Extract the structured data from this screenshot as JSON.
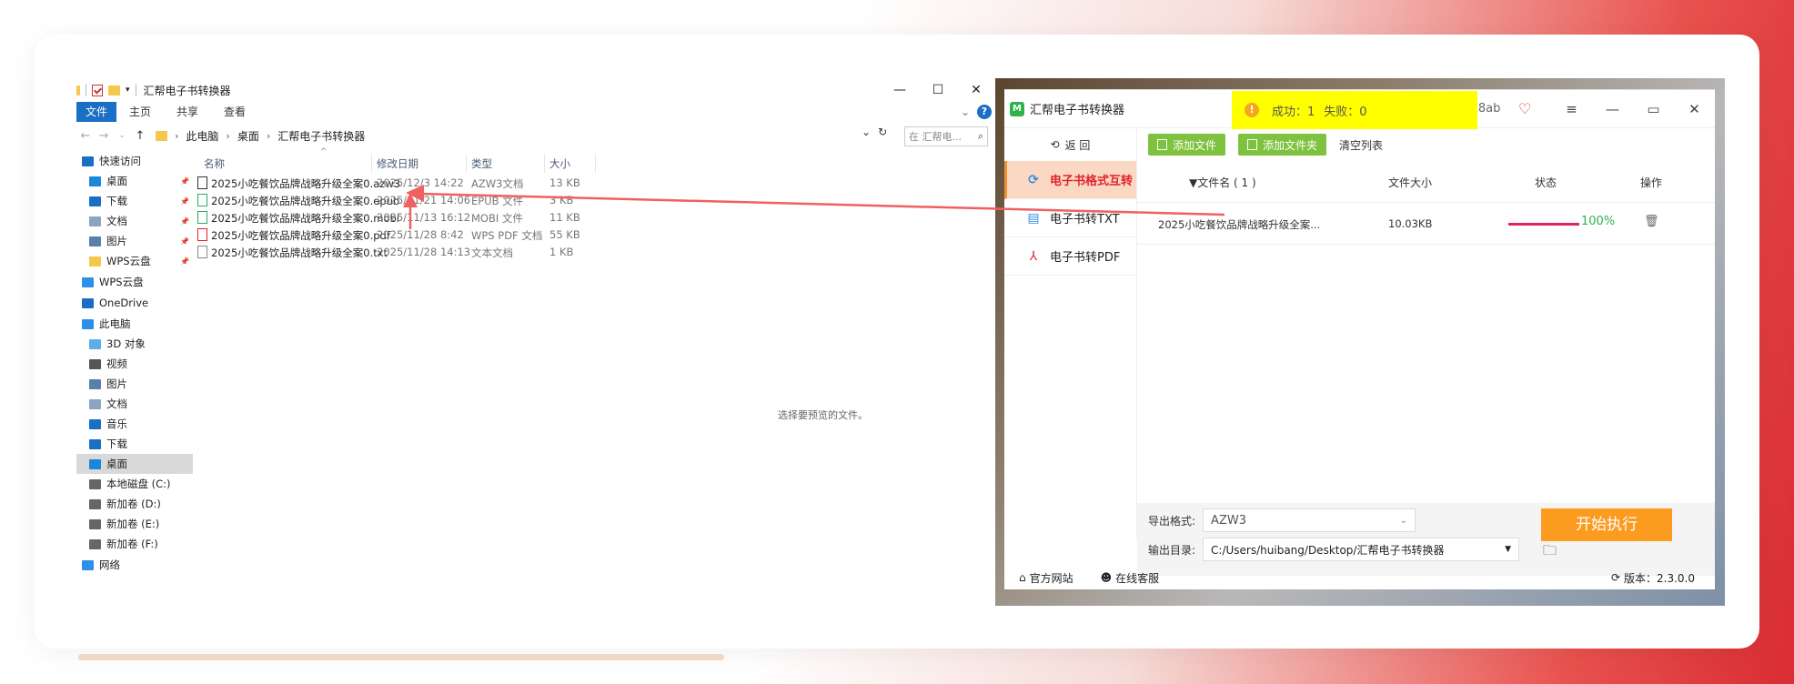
{
  "explorer": {
    "title": "汇帮电子书转换器",
    "window_controls": {
      "minimize": "—",
      "maximize": "☐",
      "close": "✕"
    },
    "ribbon": {
      "tabs": [
        "文件",
        "主页",
        "共享",
        "查看"
      ],
      "expand": "⌄",
      "help": "?"
    },
    "breadcrumbs": [
      "此电脑",
      "桌面",
      "汇帮电子书转换器"
    ],
    "search_placeholder": "在 汇帮电...",
    "nav": [
      {
        "label": "快速访问",
        "icon": "star-icon",
        "color": "#1a6fc4",
        "indent": 0,
        "pinned": false
      },
      {
        "label": "桌面",
        "icon": "desktop-icon",
        "color": "#1a88d8",
        "indent": 1,
        "pinned": true
      },
      {
        "label": "下载",
        "icon": "download-icon",
        "color": "#1a6fc4",
        "indent": 1,
        "pinned": true
      },
      {
        "label": "文档",
        "icon": "document-icon",
        "color": "#8aa4c2",
        "indent": 1,
        "pinned": true
      },
      {
        "label": "图片",
        "icon": "picture-icon",
        "color": "#5a7fa8",
        "indent": 1,
        "pinned": true
      },
      {
        "label": "WPS云盘",
        "icon": "folder-icon",
        "color": "#f5c84b",
        "indent": 1,
        "pinned": true
      },
      {
        "label": "WPS云盘",
        "icon": "cloud-icon",
        "color": "#2d8fe5",
        "indent": 0,
        "pinned": false,
        "gap": true
      },
      {
        "label": "OneDrive",
        "icon": "onedrive-icon",
        "color": "#1a6fc4",
        "indent": 0,
        "pinned": false,
        "gap": true
      },
      {
        "label": "此电脑",
        "icon": "computer-icon",
        "color": "#2d8fe5",
        "indent": 0,
        "pinned": false,
        "gap": true
      },
      {
        "label": "3D 对象",
        "icon": "3d-objects-icon",
        "color": "#5ab0e6",
        "indent": 1,
        "pinned": false
      },
      {
        "label": "视频",
        "icon": "video-icon",
        "color": "#555",
        "indent": 1,
        "pinned": false
      },
      {
        "label": "图片",
        "icon": "picture-icon",
        "color": "#5a7fa8",
        "indent": 1,
        "pinned": false
      },
      {
        "label": "文档",
        "icon": "document-icon",
        "color": "#8aa4c2",
        "indent": 1,
        "pinned": false
      },
      {
        "label": "音乐",
        "icon": "music-icon",
        "color": "#1a6fc4",
        "indent": 1,
        "pinned": false
      },
      {
        "label": "下载",
        "icon": "download-icon",
        "color": "#1a6fc4",
        "indent": 1,
        "pinned": false
      },
      {
        "label": "桌面",
        "icon": "desktop-icon",
        "color": "#1a88d8",
        "indent": 1,
        "pinned": false,
        "selected": true
      },
      {
        "label": "本地磁盘 (C:)",
        "icon": "drive-icon",
        "color": "#666",
        "indent": 1,
        "pinned": false
      },
      {
        "label": "新加卷 (D:)",
        "icon": "drive-icon",
        "color": "#666",
        "indent": 1,
        "pinned": false
      },
      {
        "label": "新加卷 (E:)",
        "icon": "drive-icon",
        "color": "#666",
        "indent": 1,
        "pinned": false
      },
      {
        "label": "新加卷 (F:)",
        "icon": "drive-icon",
        "color": "#666",
        "indent": 1,
        "pinned": false
      },
      {
        "label": "网络",
        "icon": "network-icon",
        "color": "#2d8fe5",
        "indent": 0,
        "pinned": false,
        "gap": true
      }
    ],
    "columns": [
      "名称",
      "修改日期",
      "类型",
      "大小"
    ],
    "files": [
      {
        "name": "2025小吃餐饮品牌战略升级全案0.azw3",
        "date": "2025/12/3 14:22",
        "type": "AZW3文档",
        "size": "13 KB",
        "icon_color": "#333"
      },
      {
        "name": "2025小吃餐饮品牌战略升级全案0.epub",
        "date": "2025/11/21 14:06",
        "type": "EPUB 文件",
        "size": "3 KB",
        "icon_color": "#2fa86a"
      },
      {
        "name": "2025小吃餐饮品牌战略升级全案0.mobi",
        "date": "2025/11/13 16:12",
        "type": "MOBI 文件",
        "size": "11 KB",
        "icon_color": "#2fa86a"
      },
      {
        "name": "2025小吃餐饮品牌战略升级全案0.pdf",
        "date": "2025/11/28 8:42",
        "type": "WPS PDF 文档",
        "size": "55 KB",
        "icon_color": "#e0242c"
      },
      {
        "name": "2025小吃餐饮品牌战略升级全案0.txt",
        "date": "2025/11/28 14:13",
        "type": "文本文档",
        "size": "1 KB",
        "icon_color": "#888"
      }
    ],
    "preview_text": "选择要预览的文件。"
  },
  "converter": {
    "title": "汇帮电子书转换器",
    "user_tag": "X8ab",
    "toast": {
      "success": "成功：1",
      "fail": "失败：0"
    },
    "back": {
      "back": "返 回"
    },
    "sidebar": [
      {
        "label": "电子书格式互转",
        "icon": "convert-icon",
        "active": true
      },
      {
        "label": "电子书转TXT",
        "icon": "txt-icon",
        "active": false
      },
      {
        "label": "电子书转PDF",
        "icon": "pdf-icon",
        "active": false
      }
    ],
    "toolbar": {
      "add_file": "添加文件",
      "add_folder": "添加文件夹",
      "clear": "清空列表"
    },
    "table": {
      "headers": {
        "name": "▼文件名 ( 1 )",
        "size": "文件大小",
        "status": "状态",
        "action": "操作"
      },
      "rows": [
        {
          "name": "2025小吃餐饮品牌战略升级全案...",
          "size": "10.03KB",
          "progress": 1.0,
          "status": "100%"
        }
      ]
    },
    "form": {
      "format_label": "导出格式:",
      "format_value": "AZW3",
      "dir_label": "输出目录:",
      "dir_value": "C:/Users/huibang/Desktop/汇帮电子书转换器"
    },
    "run_button": "开始执行",
    "footer": {
      "website": "官方网站",
      "support": "在线客服",
      "version": "版本：2.3.0.0"
    },
    "colors": {
      "accent": "#fb9b1f",
      "active_bg": "#fbd8c3",
      "toast": "#ffff00",
      "green": "#7fc23f",
      "progress": "#e0245e",
      "arrow": "#f06060"
    }
  }
}
